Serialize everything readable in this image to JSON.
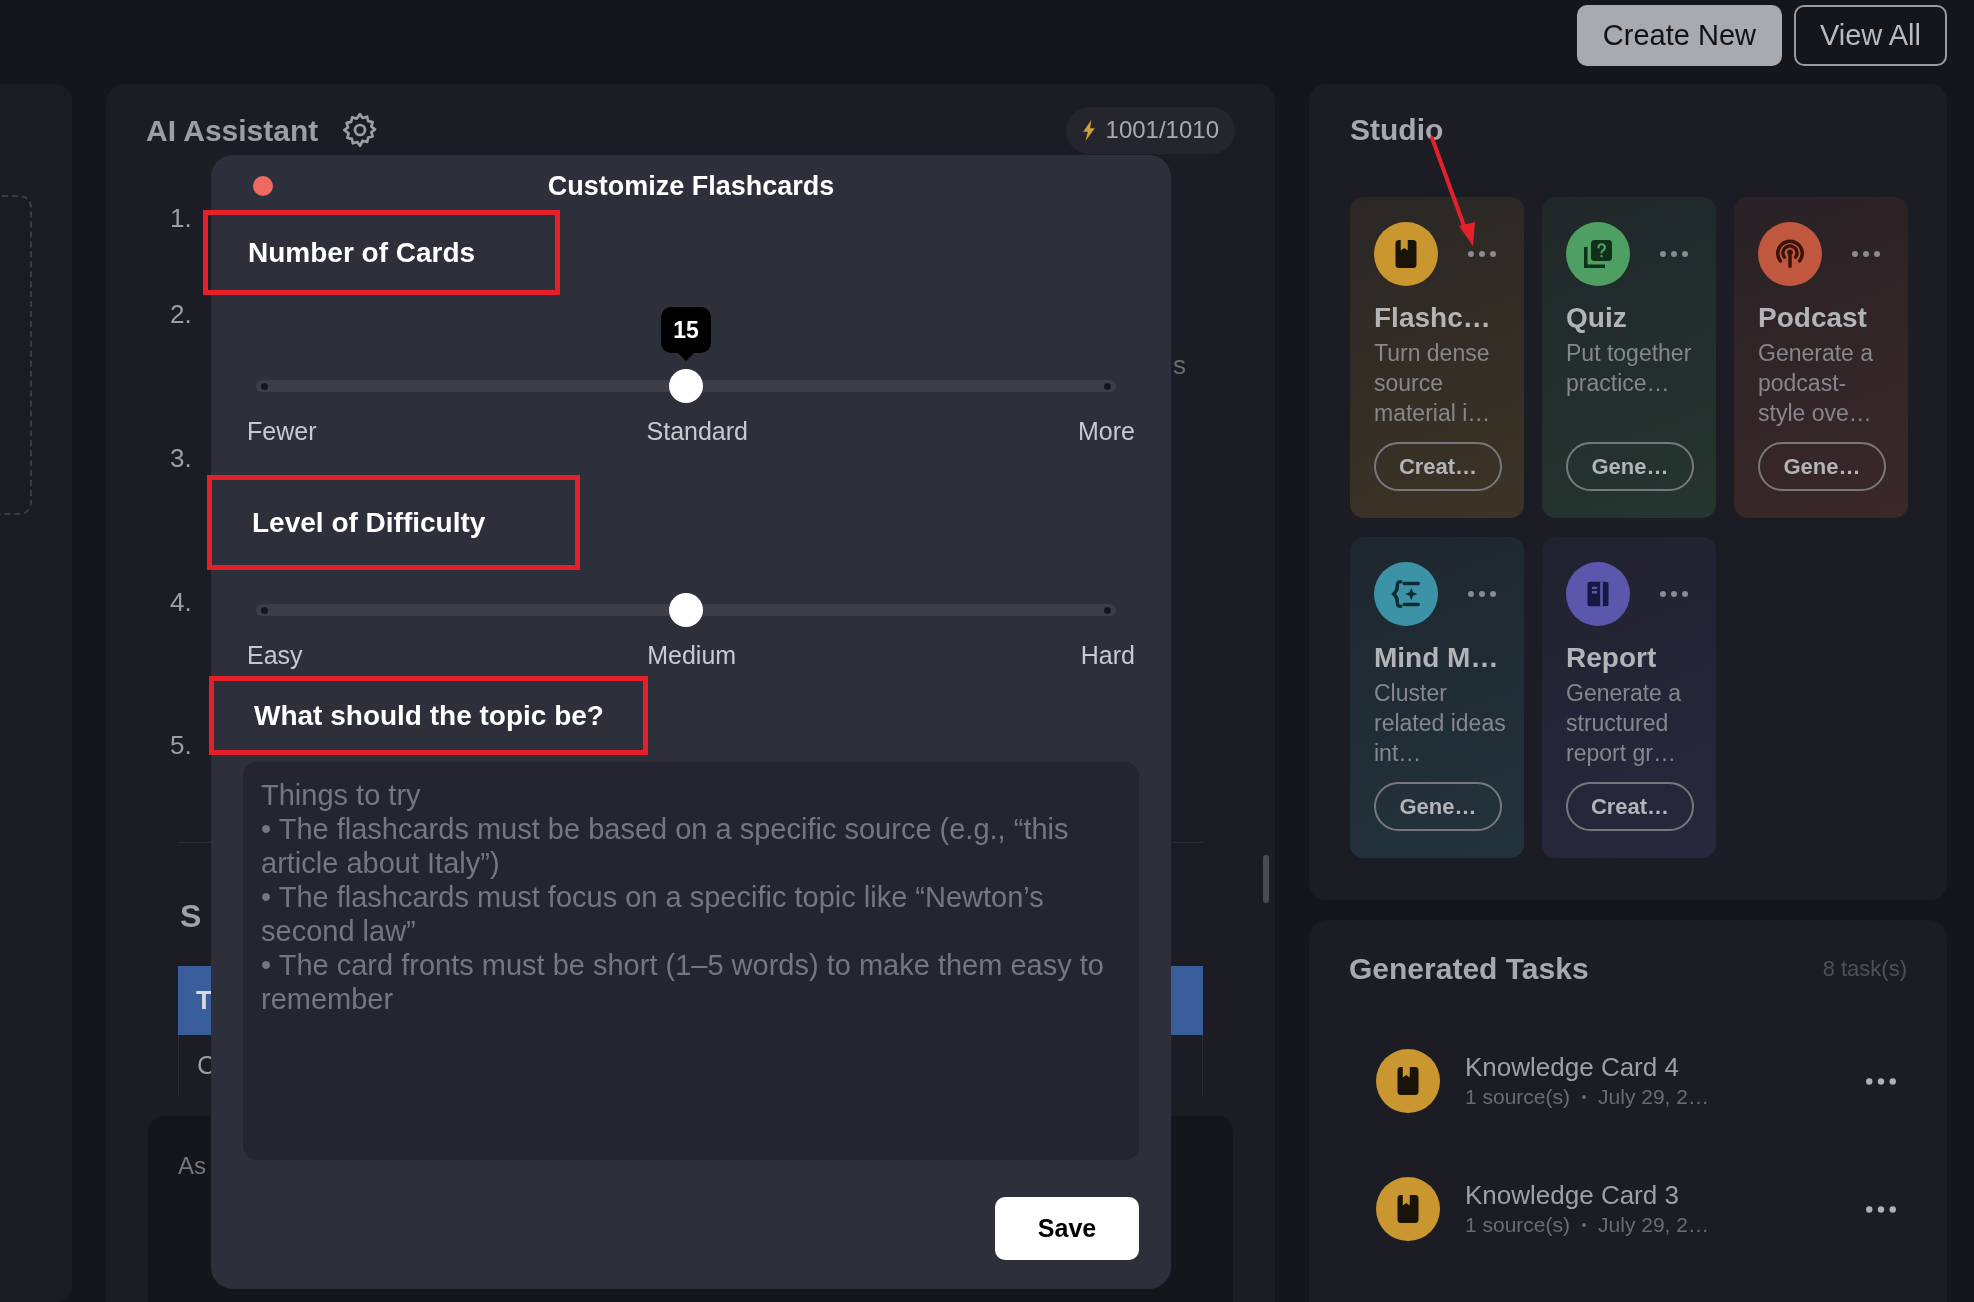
{
  "top_bar": {
    "buttons": [
      {
        "label": "Create New",
        "kind": "filled"
      },
      {
        "label": "View All",
        "kind": "outline"
      }
    ]
  },
  "assistant": {
    "title": "AI Assistant",
    "credits": "1001/1010",
    "steps": [
      "1.",
      "2.",
      "3.",
      "4.",
      "5."
    ],
    "step_fragment": "s",
    "section_heading": "S",
    "table_header": "T",
    "table_cell": "C",
    "input_placeholder": "As"
  },
  "modal": {
    "title": "Customize Flashcards",
    "save": "Save",
    "sections": [
      {
        "kind": "slider",
        "label": "Number of Cards",
        "highlighted": true,
        "level": 0.5,
        "value": "15",
        "ticks": [
          "Fewer",
          "Standard",
          "More"
        ]
      },
      {
        "kind": "slider",
        "label": "Level of Difficulty",
        "highlighted": true,
        "level": 0.5,
        "ticks": [
          "Easy",
          "Medium",
          "Hard"
        ]
      },
      {
        "kind": "text",
        "label": "What should the topic be?",
        "highlighted": true,
        "placeholder": "Things to try\n• The flashcards must be based on a specific source (e.g., “this article about Italy”)\n• The flashcards must focus on a specific topic like “Newton’s second law”\n• The card fronts must be short (1–5 words) to make them easy to remember"
      }
    ]
  },
  "studio": {
    "title": "Studio",
    "arrow": true,
    "cards": [
      {
        "kind": "flashcards",
        "title": "Flashc…",
        "description": "Turn dense source material i…",
        "action": "Creat…",
        "color": "#c9962f"
      },
      {
        "kind": "quiz",
        "title": "Quiz",
        "description": "Put together practice…",
        "action": "Gene…",
        "color": "#4f9e63"
      },
      {
        "kind": "podcast",
        "title": "Podcast",
        "description": "Generate a podcast-style ove…",
        "action": "Gene…",
        "color": "#c0573f"
      },
      {
        "kind": "mind_map",
        "title": "Mind M…",
        "description": "Cluster related ideas int…",
        "action": "Gene…",
        "color": "#3d93a6"
      },
      {
        "kind": "report",
        "title": "Report",
        "description": "Generate a structured report gr…",
        "action": "Creat…",
        "color": "#5b57ad"
      }
    ]
  },
  "tasks": {
    "title": "Generated Tasks",
    "count": "8 task(s)",
    "items": [
      {
        "kind": "flashcards",
        "title": "Knowledge Card 4",
        "sources": "1 source(s)",
        "date": "July 29, 2…"
      },
      {
        "kind": "flashcards",
        "title": "Knowledge Card 3",
        "sources": "1 source(s)",
        "date": "July 29, 2…"
      }
    ]
  }
}
